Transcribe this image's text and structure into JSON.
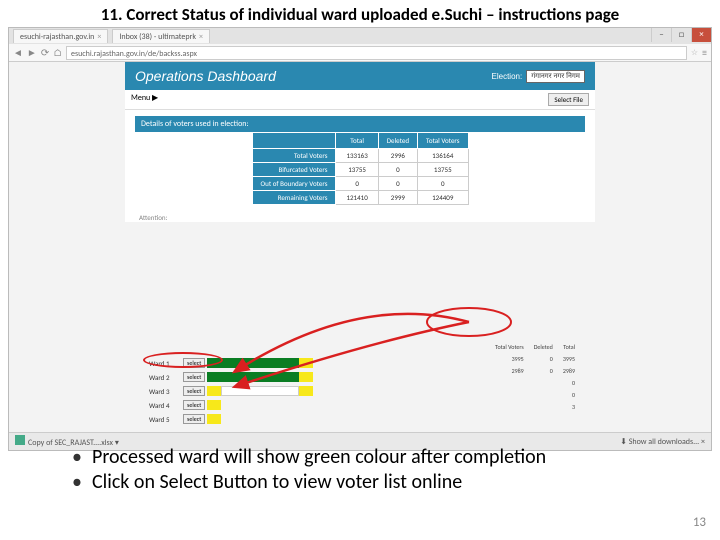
{
  "title": "11.  Correct Status of individual ward uploaded e.Suchi – instructions page",
  "browser": {
    "tabs": [
      "esuchi-rajasthan.gov.in",
      "Inbox (38) - ultimateprk"
    ],
    "url": "esuchi.rajasthan.gov.in/de/backss.aspx",
    "winClose": "×",
    "home": "⌂",
    "star": "☆",
    "menu": "≡"
  },
  "dashboard": {
    "title": "Operations Dashboard",
    "electionLabel": "Election:",
    "electionValue": "गंगानगर नगर निगम",
    "menu": "Menu ▶",
    "selectFile": "Select File",
    "sectionHeader": "Details of voters used in election:",
    "cols": [
      "",
      "Total",
      "Deleted",
      "Total Voters"
    ],
    "rows": [
      {
        "label": "Total Voters",
        "vals": [
          "133163",
          "2996",
          "136164"
        ]
      },
      {
        "label": "Bifurcated Voters",
        "vals": [
          "13755",
          "0",
          "13755"
        ]
      },
      {
        "label": "Out of Boundary Voters",
        "vals": [
          "0",
          "0",
          "0"
        ]
      },
      {
        "label": "Remaining Voters",
        "vals": [
          "121410",
          "2999",
          "124409"
        ]
      }
    ],
    "attention": "Attention:",
    "wards": [
      {
        "name": "Ward 1",
        "sel": "select",
        "segs": [
          {
            "c": "#0a7d23",
            "w": 46
          },
          {
            "c": "#0a7d23",
            "w": 46
          },
          {
            "c": "#f7e81a",
            "w": 14
          }
        ]
      },
      {
        "name": "Ward 2",
        "sel": "select",
        "segs": [
          {
            "c": "#0a7d23",
            "w": 92
          },
          {
            "c": "#f7e81a",
            "w": 14
          }
        ]
      },
      {
        "name": "Ward 3",
        "sel": "select",
        "segs": [
          {
            "c": "#f7e81a",
            "w": 14
          },
          {
            "c": "#ffffff",
            "w": 78
          },
          {
            "c": "#f7e81a",
            "w": 14
          }
        ]
      },
      {
        "name": "Ward 4",
        "sel": "select",
        "segs": [
          {
            "c": "#f7e81a",
            "w": 14
          }
        ]
      },
      {
        "name": "Ward 5",
        "sel": "select",
        "segs": [
          {
            "c": "#f7e81a",
            "w": 14
          }
        ]
      }
    ],
    "side": {
      "heads": [
        "Total Voters",
        "Deleted",
        "Total"
      ],
      "rows": [
        [
          "3995",
          "0",
          "3995"
        ],
        [
          "2989",
          "0",
          "2989"
        ],
        [
          "",
          "",
          "0"
        ],
        [
          "",
          "",
          "0"
        ],
        [
          "",
          "",
          "3"
        ]
      ]
    }
  },
  "downloads": {
    "file": "Copy of SEC_RAJAST....xlsx",
    "showAll": "Show all downloads..."
  },
  "bullets": [
    "Processed ward will show green colour after completion",
    "Click on Select Button to view voter list online"
  ],
  "pageNumber": "13"
}
